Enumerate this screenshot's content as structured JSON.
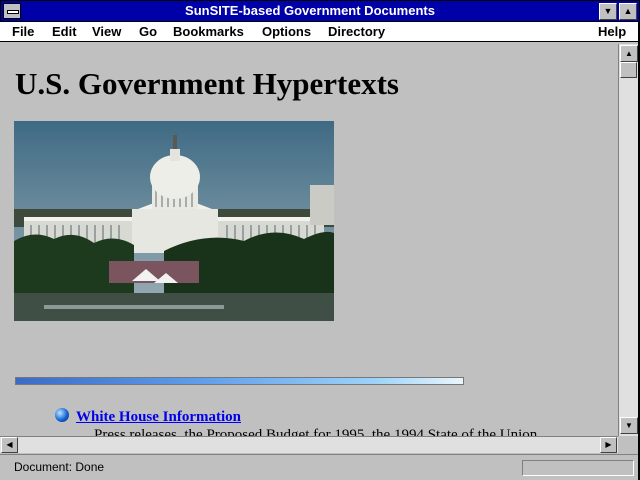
{
  "window": {
    "title": "SunSITE-based Government Documents"
  },
  "menu": {
    "items": [
      "File",
      "Edit",
      "View",
      "Go",
      "Bookmarks",
      "Options",
      "Directory"
    ],
    "help": "Help"
  },
  "page": {
    "heading": "U.S. Government Hypertexts",
    "link_white_house": "White House Information",
    "description": "Press releases, the Proposed Budget for 1995, the 1994 State of the Union"
  },
  "status": {
    "text": "Document: Done"
  },
  "colors": {
    "titlebar": "#0000a8",
    "link": "#0000ee",
    "background": "#c0c0c0"
  },
  "icons": {
    "bullet": "blue-ball-icon",
    "image": "us-capitol-photo"
  }
}
